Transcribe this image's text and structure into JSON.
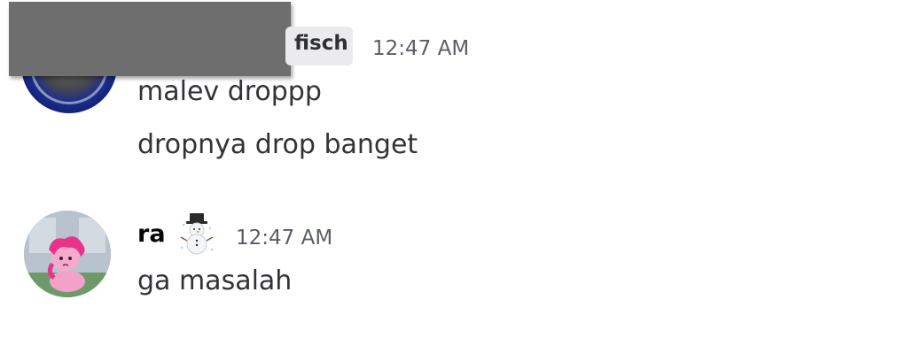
{
  "messages": [
    {
      "author": "",
      "role_tag": "fisch",
      "timestamp": "12:47 AM",
      "lines": [
        "malev droppp",
        "dropnya drop banget"
      ]
    },
    {
      "author": "ra",
      "author_badge_icon": "snowman-icon",
      "timestamp": "12:47 AM",
      "lines": [
        "ga masalah"
      ]
    }
  ],
  "colors": {
    "background": "#ffffff",
    "message_text": "#313338",
    "timestamp": "#5c5e66",
    "role_tag_bg": "#ebebed"
  }
}
